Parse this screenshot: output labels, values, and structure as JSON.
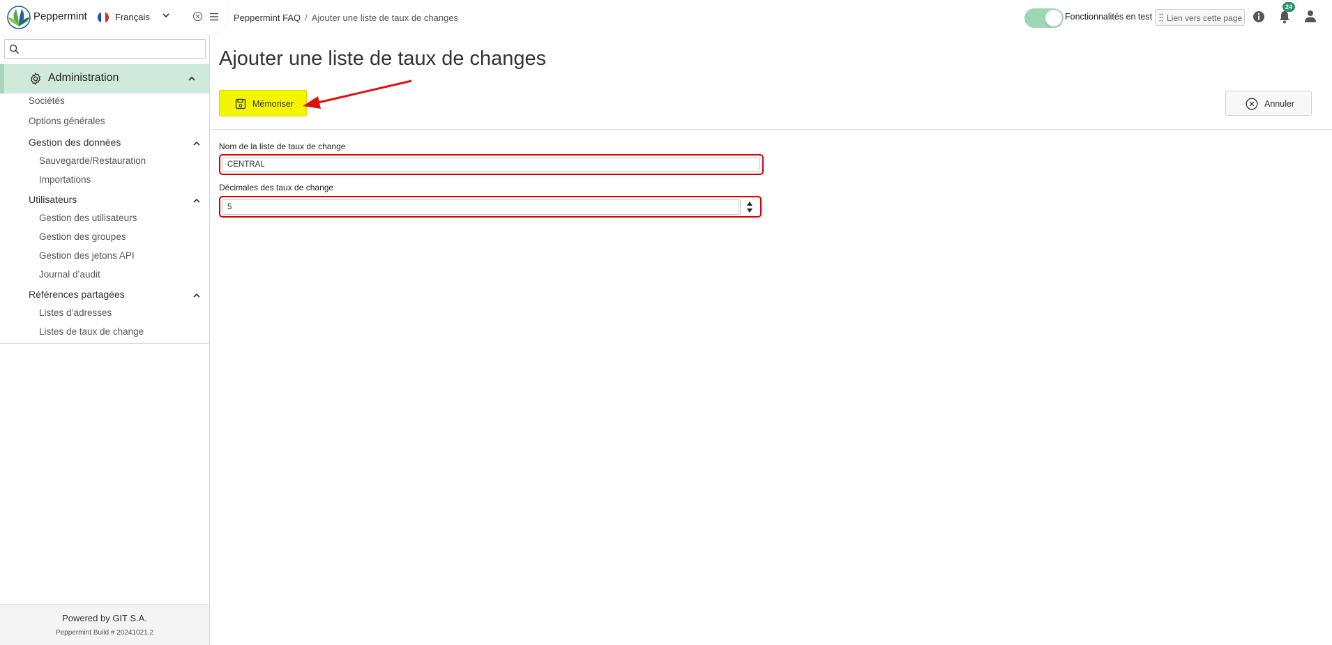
{
  "app": {
    "name": "Peppermint"
  },
  "language": {
    "selected": "Français"
  },
  "search": {
    "value": "",
    "placeholder": ""
  },
  "sidebar": {
    "section": "Administration",
    "items": [
      {
        "label": "Sociétés"
      },
      {
        "label": "Options générales"
      }
    ],
    "groups": [
      {
        "label": "Gestion des données",
        "items": [
          "Sauvegarde/Restauration",
          "Importations"
        ]
      },
      {
        "label": "Utilisateurs",
        "items": [
          "Gestion des utilisateurs",
          "Gestion des groupes",
          "Gestion des jetons API",
          "Journal d’audit"
        ]
      },
      {
        "label": "Références partagées",
        "items": [
          "Listes d’adresses",
          "Listes de taux de change"
        ]
      }
    ],
    "footer": {
      "powered": "Powered by GIT S.A.",
      "build": "Peppermint Build # 20241021.2"
    }
  },
  "header": {
    "breadcrumb": [
      "Peppermint FAQ",
      "Ajouter une liste de taux de changes"
    ],
    "features_label": "Fonctionnalités en test",
    "link_label": "Lien vers cette page",
    "notification_count": "24"
  },
  "page": {
    "title": "Ajouter une liste de taux de changes",
    "save_label": "Mémoriser",
    "cancel_label": "Annuler"
  },
  "form": {
    "name_label": "Nom de la liste de taux de change",
    "name_value": "CENTRAL",
    "decimals_label": "Décimales des taux de change",
    "decimals_value": "5"
  },
  "colors": {
    "accent": "#cfeadb",
    "highlight": "#f5f500",
    "annotation": "#d90000",
    "badge": "#2f8f6f"
  }
}
